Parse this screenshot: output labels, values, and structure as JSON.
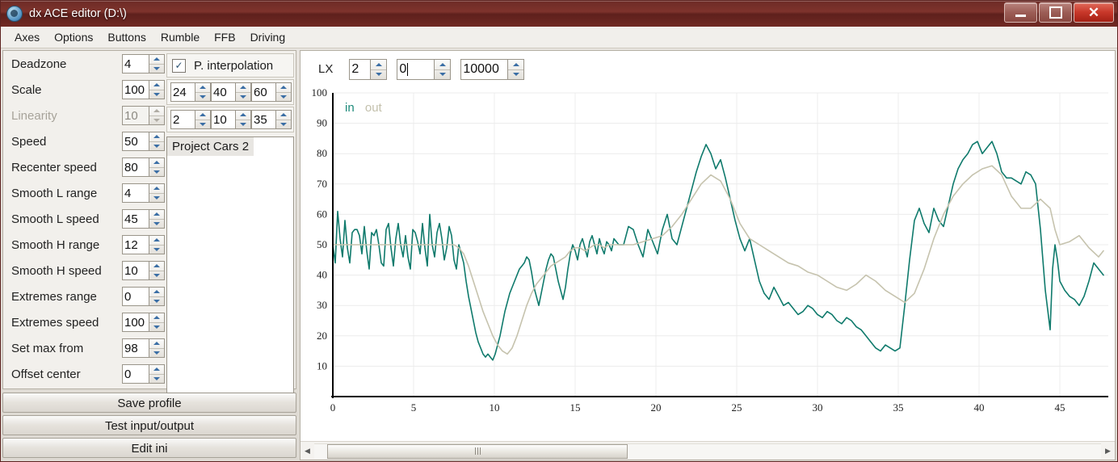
{
  "window": {
    "title": "dx ACE editor (D:\\)",
    "icon": "app-paw-icon",
    "minimize_label": "",
    "maximize_label": "",
    "close_label": "✕"
  },
  "menu": {
    "items": [
      "Axes",
      "Options",
      "Buttons",
      "Rumble",
      "FFB",
      "Driving"
    ]
  },
  "params": {
    "rows": [
      {
        "label": "Deadzone",
        "value": "4",
        "disabled": false
      },
      {
        "label": "Scale",
        "value": "100",
        "disabled": false
      },
      {
        "label": "Linearity",
        "value": "10",
        "disabled": true
      },
      {
        "label": "Speed",
        "value": "50",
        "disabled": false
      },
      {
        "label": "Recenter speed",
        "value": "80",
        "disabled": false
      },
      {
        "label": "Smooth L range",
        "value": "4",
        "disabled": false
      },
      {
        "label": "Smooth L speed",
        "value": "45",
        "disabled": false
      },
      {
        "label": "Smooth H range",
        "value": "12",
        "disabled": false
      },
      {
        "label": "Smooth H speed",
        "value": "10",
        "disabled": false
      },
      {
        "label": "Extremes range",
        "value": "0",
        "disabled": false
      },
      {
        "label": "Extremes speed",
        "value": "100",
        "disabled": false
      },
      {
        "label": "Set max from",
        "value": "98",
        "disabled": false
      },
      {
        "label": "Offset center",
        "value": "0",
        "disabled": false
      }
    ]
  },
  "interpolation": {
    "checked": true,
    "check_glyph": "✓",
    "label": "P. interpolation",
    "row1": [
      "24",
      "40",
      "60"
    ],
    "row2": [
      "2",
      "10",
      "35"
    ]
  },
  "profiles": {
    "items": [
      "Project Cars 2"
    ],
    "selected": "Project Cars 2"
  },
  "buttons": {
    "save": "Save profile",
    "test": "Test input/output",
    "edit": "Edit ini"
  },
  "toolbar": {
    "axis_label": "LX",
    "field1": "2",
    "field2": "0",
    "field3": "10000"
  },
  "scrollbar": {
    "left_arrow": "◀",
    "right_arrow": "▶"
  },
  "colors": {
    "in": "#0f7a6c",
    "out": "#c6c3ae",
    "titlebar": "#6d2b26",
    "accent": "#3a6ea5"
  },
  "chart_data": {
    "type": "line",
    "title": "",
    "xlabel": "",
    "ylabel": "",
    "xlim": [
      0,
      48
    ],
    "ylim": [
      0,
      100
    ],
    "grid": true,
    "legend_position": "top-left",
    "xticks": [
      0,
      5,
      10,
      15,
      20,
      25,
      30,
      35,
      40,
      45
    ],
    "yticks": [
      10,
      20,
      30,
      40,
      50,
      60,
      70,
      80,
      90,
      100
    ],
    "legend": [
      "in",
      "out"
    ],
    "series": [
      {
        "name": "in",
        "color": "#0f7a6c",
        "x": [
          0,
          0.15,
          0.3,
          0.45,
          0.6,
          0.75,
          0.9,
          1.05,
          1.2,
          1.35,
          1.5,
          1.65,
          1.8,
          1.95,
          2.1,
          2.25,
          2.4,
          2.55,
          2.7,
          2.85,
          3,
          3.15,
          3.3,
          3.45,
          3.6,
          3.75,
          3.9,
          4.05,
          4.2,
          4.35,
          4.5,
          4.65,
          4.8,
          4.95,
          5.1,
          5.25,
          5.4,
          5.55,
          5.7,
          5.85,
          6,
          6.15,
          6.3,
          6.45,
          6.6,
          6.75,
          6.9,
          7.05,
          7.2,
          7.35,
          7.5,
          7.65,
          7.8,
          7.95,
          8.1,
          8.25,
          8.4,
          8.55,
          8.7,
          8.85,
          9,
          9.15,
          9.3,
          9.45,
          9.6,
          9.75,
          9.9,
          10.05,
          10.2,
          10.35,
          10.5,
          10.65,
          10.8,
          10.95,
          11.1,
          11.25,
          11.4,
          11.55,
          11.7,
          11.85,
          12,
          12.15,
          12.3,
          12.45,
          12.6,
          12.75,
          12.9,
          13.05,
          13.2,
          13.35,
          13.5,
          13.65,
          13.8,
          13.95,
          14.1,
          14.25,
          14.4,
          14.55,
          14.7,
          14.85,
          15,
          15.15,
          15.3,
          15.45,
          15.6,
          15.75,
          15.9,
          16.05,
          16.2,
          16.35,
          16.5,
          16.65,
          16.8,
          16.95,
          17.1,
          17.25,
          17.4,
          17.55,
          17.7,
          17.85,
          18,
          18.3,
          18.6,
          18.9,
          19.2,
          19.5,
          19.8,
          20.1,
          20.4,
          20.7,
          21,
          21.3,
          21.6,
          21.9,
          22.2,
          22.5,
          22.8,
          23.1,
          23.4,
          23.7,
          24,
          24.3,
          24.6,
          24.9,
          25.2,
          25.5,
          25.8,
          26.1,
          26.4,
          26.7,
          27,
          27.3,
          27.6,
          27.9,
          28.2,
          28.5,
          28.8,
          29.1,
          29.4,
          29.7,
          30,
          30.3,
          30.6,
          30.9,
          31.2,
          31.5,
          31.8,
          32.1,
          32.4,
          32.7,
          33,
          33.3,
          33.6,
          33.9,
          34.2,
          34.5,
          34.8,
          35.1,
          35.4,
          35.7,
          36,
          36.3,
          36.6,
          36.9,
          37.2,
          37.5,
          37.8,
          38.1,
          38.4,
          38.7,
          39,
          39.3,
          39.6,
          39.9,
          40.2,
          40.5,
          40.8,
          41.1,
          41.4,
          41.7,
          42,
          42.3,
          42.6,
          42.9,
          43.2,
          43.5,
          43.8,
          44.1,
          44.4,
          44.55,
          44.7,
          44.85,
          45,
          45.3,
          45.6,
          45.9,
          46.2,
          46.5,
          46.8,
          47.1,
          47.4,
          47.7
        ],
        "y": [
          50,
          44,
          61,
          52,
          46,
          58,
          49,
          44,
          54,
          55,
          55,
          53,
          47,
          56,
          48,
          42,
          54,
          53,
          55,
          50,
          44,
          43,
          55,
          57,
          49,
          43,
          52,
          57,
          50,
          46,
          53,
          46,
          42,
          55,
          54,
          51,
          47,
          57,
          49,
          43,
          60,
          50,
          46,
          54,
          57,
          52,
          45,
          49,
          56,
          53,
          45,
          42,
          50,
          47,
          44,
          38,
          33,
          29,
          25,
          21,
          18,
          16,
          14,
          13,
          14,
          13,
          12,
          14,
          17,
          20,
          24,
          28,
          31,
          34,
          36,
          38,
          40,
          42,
          43,
          44,
          46,
          45,
          41,
          36,
          33,
          30,
          34,
          38,
          42,
          45,
          47,
          46,
          42,
          38,
          35,
          32,
          36,
          42,
          47,
          50,
          48,
          45,
          50,
          52,
          49,
          46,
          51,
          53,
          50,
          47,
          52,
          49,
          47,
          51,
          50,
          48,
          52,
          51,
          50,
          50,
          50,
          56,
          55,
          50,
          46,
          55,
          51,
          47,
          55,
          60,
          52,
          50,
          56,
          62,
          68,
          74,
          79,
          83,
          80,
          75,
          78,
          72,
          65,
          58,
          52,
          48,
          52,
          45,
          38,
          34,
          32,
          36,
          33,
          30,
          31,
          29,
          27,
          28,
          30,
          29,
          27,
          26,
          28,
          27,
          25,
          24,
          26,
          25,
          23,
          22,
          20,
          18,
          16,
          15,
          17,
          16,
          15,
          16,
          30,
          45,
          58,
          62,
          57,
          54,
          62,
          58,
          56,
          63,
          70,
          75,
          78,
          80,
          83,
          84,
          80,
          82,
          84,
          80,
          74,
          72,
          72,
          71,
          70,
          74,
          73,
          70,
          55,
          35,
          22,
          42,
          50,
          45,
          38,
          35,
          33,
          32,
          30,
          33,
          38,
          44,
          42,
          40,
          42
        ]
      },
      {
        "name": "out",
        "color": "#c6c3ae",
        "x": [
          0,
          0.3,
          0.6,
          0.9,
          1.2,
          1.5,
          1.8,
          2.1,
          2.4,
          2.7,
          3,
          3.3,
          3.6,
          3.9,
          4.2,
          4.5,
          4.8,
          5.1,
          5.4,
          5.7,
          6,
          6.3,
          6.6,
          6.9,
          7.2,
          7.5,
          7.8,
          8.1,
          8.4,
          8.7,
          9,
          9.3,
          9.6,
          9.9,
          10.2,
          10.5,
          10.8,
          11.1,
          11.4,
          11.7,
          12,
          12.3,
          12.6,
          12.9,
          13.2,
          13.5,
          13.8,
          14.1,
          14.4,
          14.7,
          15,
          15.3,
          15.6,
          15.9,
          16.2,
          16.5,
          16.8,
          17.1,
          17.4,
          17.7,
          18,
          18.6,
          19.2,
          19.8,
          20.4,
          21,
          21.6,
          22.2,
          22.8,
          23.4,
          24,
          24.6,
          25.2,
          25.8,
          26.4,
          27,
          27.6,
          28.2,
          28.8,
          29.4,
          30,
          30.6,
          31.2,
          31.8,
          32.4,
          33,
          33.6,
          34.2,
          34.8,
          35.4,
          36,
          36.6,
          37.2,
          37.8,
          38.4,
          39,
          39.6,
          40.2,
          40.8,
          41.4,
          42,
          42.6,
          43.2,
          43.8,
          44.4,
          44.7,
          45,
          45.6,
          46.2,
          46.8,
          47.4,
          47.7
        ],
        "y": [
          50,
          50,
          50,
          50,
          50,
          50,
          50,
          50,
          50,
          50,
          50,
          50,
          50,
          50,
          50,
          50,
          50,
          50,
          50,
          50,
          50,
          50,
          50,
          50,
          50,
          50,
          49,
          47,
          43,
          38,
          33,
          28,
          24,
          20,
          17,
          15,
          14,
          16,
          20,
          25,
          30,
          34,
          37,
          39,
          41,
          43,
          44,
          45,
          46,
          48,
          49,
          49,
          48,
          49,
          50,
          50,
          49,
          50,
          50,
          50,
          50,
          50,
          51,
          52,
          53,
          56,
          60,
          65,
          70,
          73,
          71,
          65,
          57,
          52,
          50,
          48,
          46,
          44,
          43,
          41,
          40,
          38,
          36,
          35,
          37,
          40,
          38,
          35,
          33,
          31,
          34,
          42,
          52,
          60,
          66,
          70,
          73,
          75,
          76,
          73,
          66,
          62,
          62,
          65,
          62,
          55,
          50,
          51,
          53,
          49,
          46,
          48
        ]
      }
    ]
  }
}
